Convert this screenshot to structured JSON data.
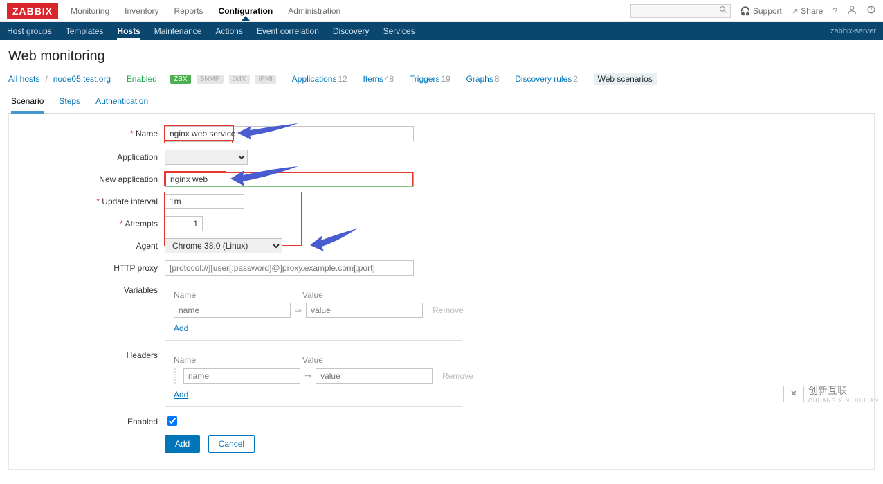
{
  "top": {
    "logo": "ZABBIX",
    "menu": [
      "Monitoring",
      "Inventory",
      "Reports",
      "Configuration",
      "Administration"
    ],
    "active_menu_index": 3,
    "support": "Support",
    "share": "Share"
  },
  "bluebar": {
    "items": [
      "Host groups",
      "Templates",
      "Hosts",
      "Maintenance",
      "Actions",
      "Event correlation",
      "Discovery",
      "Services"
    ],
    "active_index": 2,
    "right": "zabbix-server"
  },
  "page_title": "Web monitoring",
  "hostnav": {
    "all_hosts": "All hosts",
    "host": "node05.test.org",
    "enabled": "Enabled",
    "badges": [
      "ZBX",
      "SNMP",
      "JMX",
      "IPMI"
    ],
    "links": [
      {
        "label": "Applications",
        "count": "12"
      },
      {
        "label": "Items",
        "count": "48"
      },
      {
        "label": "Triggers",
        "count": "19"
      },
      {
        "label": "Graphs",
        "count": "8"
      },
      {
        "label": "Discovery rules",
        "count": "2"
      }
    ],
    "selected": "Web scenarios"
  },
  "tabs": [
    "Scenario",
    "Steps",
    "Authentication"
  ],
  "active_tab_index": 0,
  "form": {
    "name_label": "Name",
    "name_value": "nginx web service",
    "application_label": "Application",
    "application_value": "",
    "new_application_label": "New application",
    "new_application_value": "nginx web",
    "update_interval_label": "Update interval",
    "update_interval_value": "1m",
    "attempts_label": "Attempts",
    "attempts_value": "1",
    "agent_label": "Agent",
    "agent_value": "Chrome 38.0 (Linux)",
    "http_proxy_label": "HTTP proxy",
    "http_proxy_placeholder": "[protocol://][user[:password]@]proxy.example.com[:port]",
    "variables_label": "Variables",
    "headers_label": "Headers",
    "name_header": "Name",
    "value_header": "Value",
    "name_ph": "name",
    "value_ph": "value",
    "remove": "Remove",
    "add": "Add",
    "enabled_label": "Enabled",
    "enabled_checked": true,
    "btn_add": "Add",
    "btn_cancel": "Cancel"
  },
  "watermark": {
    "big": "创新互联",
    "small": "CHUANG XIN HU LIAN"
  }
}
